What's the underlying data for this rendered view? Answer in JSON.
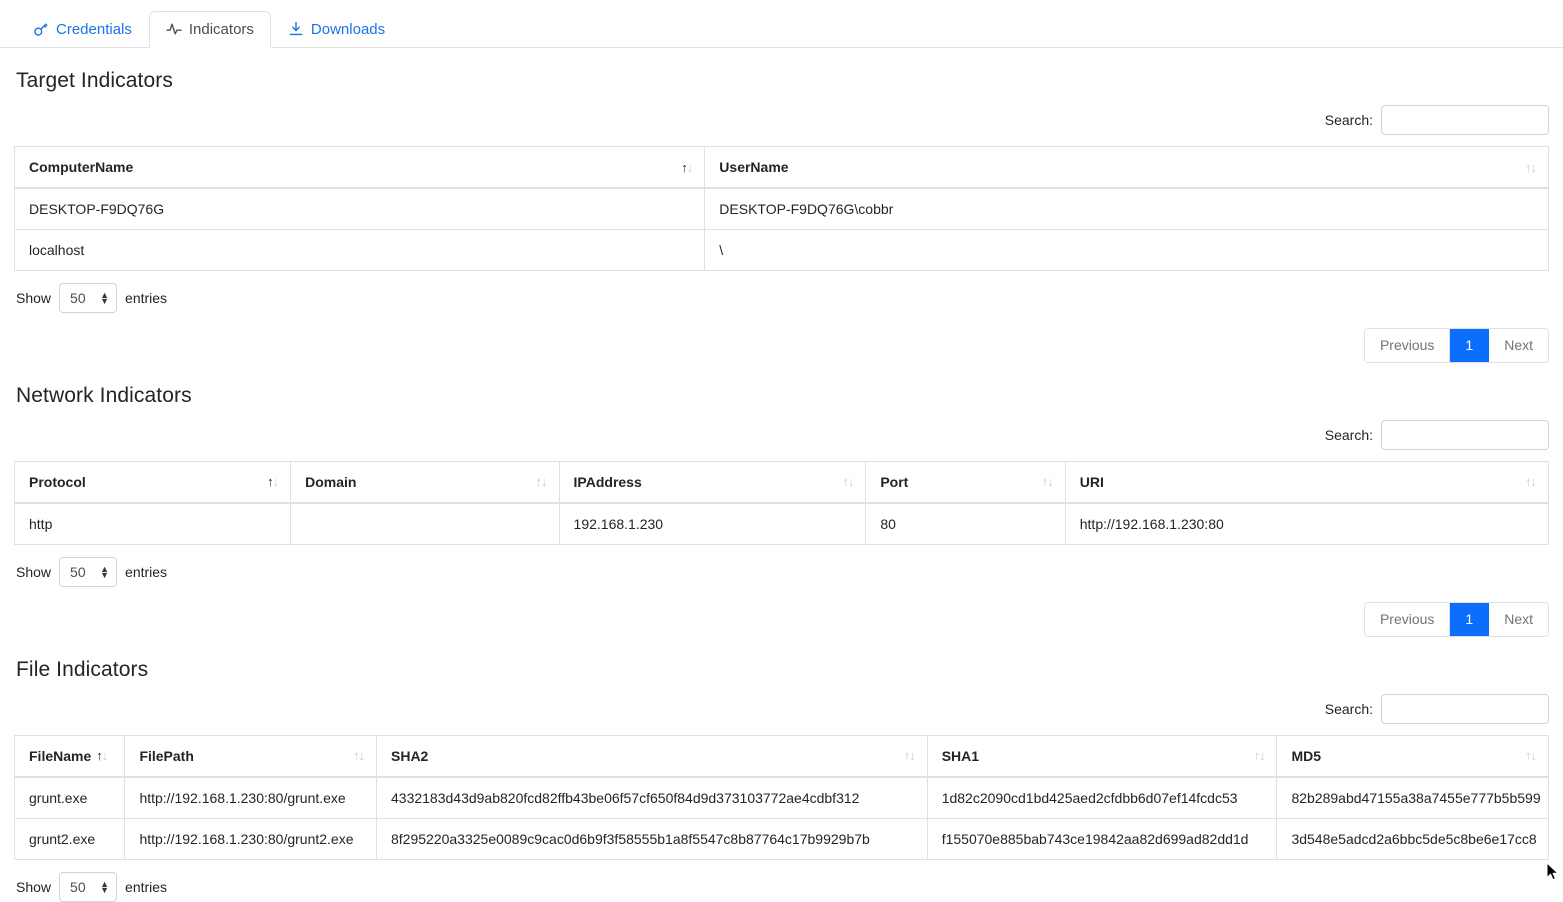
{
  "tabs": [
    {
      "label": "Credentials",
      "icon": "key-icon",
      "active": false
    },
    {
      "label": "Indicators",
      "icon": "activity-pulse-icon",
      "active": true
    },
    {
      "label": "Downloads",
      "icon": "download-icon",
      "active": false
    }
  ],
  "common": {
    "search_label": "Search:",
    "search_value": "",
    "show_label": "Show",
    "entries_label": "entries",
    "page_length": "50",
    "previous_label": "Previous",
    "next_label": "Next",
    "page_number": "1",
    "accent_color": "#0d6efd",
    "link_color": "#1a73e8"
  },
  "sections": [
    {
      "title": "Target Indicators",
      "columns": [
        {
          "label": "ComputerName",
          "sort": "asc"
        },
        {
          "label": "UserName",
          "sort": "none"
        }
      ],
      "rows": [
        [
          "DESKTOP-F9DQ76G",
          "DESKTOP-F9DQ76G\\cobbr"
        ],
        [
          "localhost",
          "\\"
        ]
      ]
    },
    {
      "title": "Network Indicators",
      "columns": [
        {
          "label": "Protocol",
          "sort": "asc"
        },
        {
          "label": "Domain",
          "sort": "none"
        },
        {
          "label": "IPAddress",
          "sort": "none"
        },
        {
          "label": "Port",
          "sort": "none"
        },
        {
          "label": "URI",
          "sort": "none"
        }
      ],
      "rows": [
        [
          "http",
          "",
          "192.168.1.230",
          "80",
          "http://192.168.1.230:80"
        ]
      ]
    },
    {
      "title": "File Indicators",
      "columns": [
        {
          "label": "FileName",
          "sort": "asc"
        },
        {
          "label": "FilePath",
          "sort": "none"
        },
        {
          "label": "SHA2",
          "sort": "none"
        },
        {
          "label": "SHA1",
          "sort": "none"
        },
        {
          "label": "MD5",
          "sort": "none"
        }
      ],
      "rows": [
        [
          "grunt.exe",
          "http://192.168.1.230:80/grunt.exe",
          "4332183d43d9ab820fcd82ffb43be06f57cf650f84d9d373103772ae4cdbf312",
          "1d82c2090cd1bd425aed2cfdbb6d07ef14fcdc53",
          "82b289abd47155a38a7455e777b5b599"
        ],
        [
          "grunt2.exe",
          "http://192.168.1.230:80/grunt2.exe",
          "8f295220a3325e0089c9cac0d6b9f3f58555b1a8f5547c8b87764c17b9929b7b",
          "f155070e885bab743ce19842aa82d699ad82dd1d",
          "3d548e5adcd2a6bbc5de5c8be6e17cc8"
        ]
      ]
    }
  ]
}
